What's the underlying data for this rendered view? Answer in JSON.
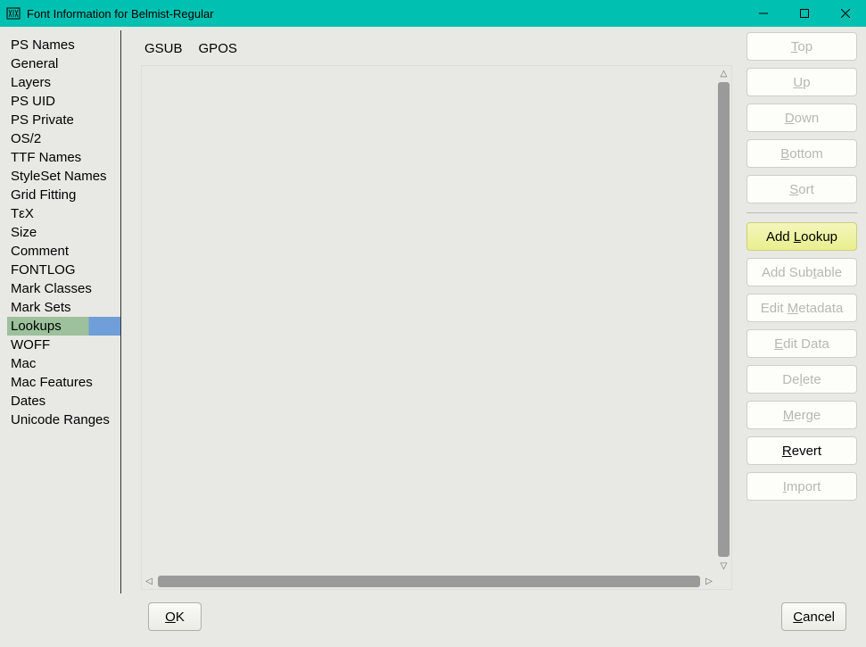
{
  "window": {
    "title": "Font Information for Belmist-Regular"
  },
  "sidebar": {
    "items": [
      "PS Names",
      "General",
      "Layers",
      "PS UID",
      "PS Private",
      "OS/2",
      "TTF Names",
      "StyleSet Names",
      "Grid Fitting",
      "TεX",
      "Size",
      "Comment",
      "FONTLOG",
      "Mark Classes",
      "Mark Sets",
      "Lookups",
      "WOFF",
      "Mac",
      "Mac Features",
      "Dates",
      "Unicode Ranges"
    ],
    "selected_index": 15
  },
  "tabs": {
    "items": [
      "GSUB",
      "GPOS"
    ],
    "active_index": 0
  },
  "buttons": {
    "top": "Top",
    "up": "Up",
    "down": "Down",
    "bottom": "Bottom",
    "sort": "Sort",
    "add_lookup": "Add Lookup",
    "add_subtable": "Add Subtable",
    "edit_metadata": "Edit Metadata",
    "edit_data": "Edit Data",
    "delete": "Delete",
    "merge": "Merge",
    "revert": "Revert",
    "import": "Import"
  },
  "footer": {
    "ok": "OK",
    "cancel": "Cancel"
  }
}
